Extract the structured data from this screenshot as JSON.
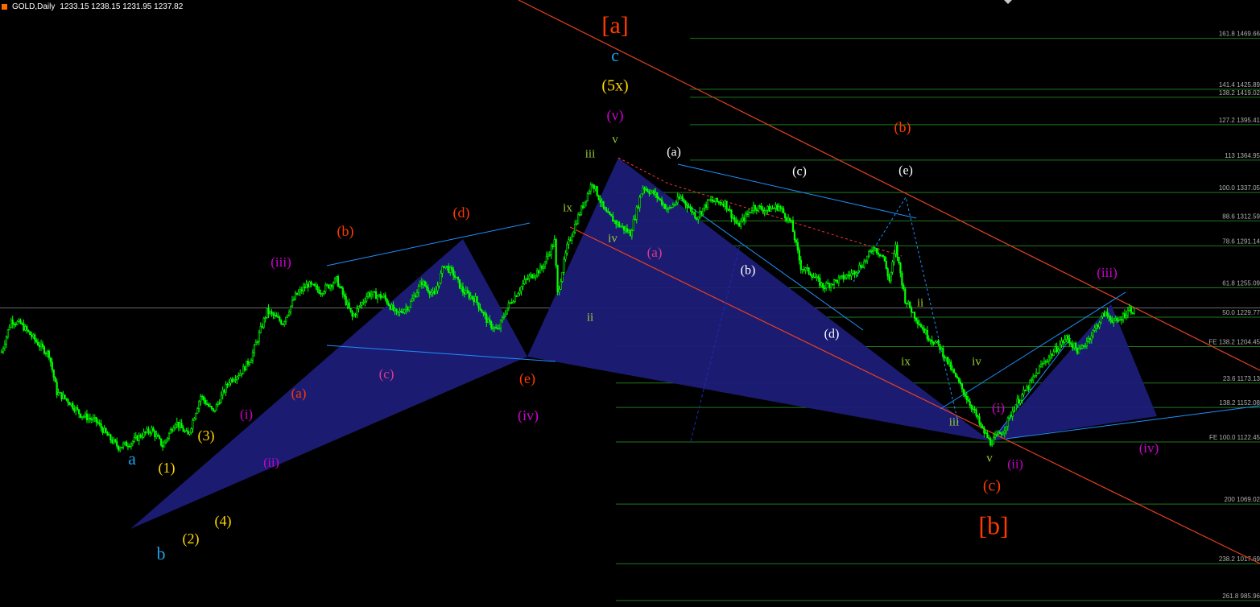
{
  "header": {
    "symbol_tf": "GOLD,Daily",
    "ohlc": "1233.15 1238.15 1231.95 1237.82"
  },
  "chart_data": {
    "type": "candlestick",
    "title": "GOLD,Daily",
    "x": "trading days (unlabeled)",
    "ylim": [
      970,
      1490
    ],
    "grid": false,
    "close_path": [
      [
        0,
        1200
      ],
      [
        6,
        1227
      ],
      [
        12,
        1224
      ],
      [
        18,
        1215
      ],
      [
        25,
        1204
      ],
      [
        30,
        1198
      ],
      [
        35,
        1165
      ],
      [
        42,
        1158
      ],
      [
        50,
        1146
      ],
      [
        60,
        1140
      ],
      [
        68,
        1126
      ],
      [
        74,
        1118
      ],
      [
        82,
        1122
      ],
      [
        88,
        1128
      ],
      [
        95,
        1133
      ],
      [
        102,
        1119
      ],
      [
        110,
        1140
      ],
      [
        118,
        1128
      ],
      [
        126,
        1162
      ],
      [
        134,
        1148
      ],
      [
        144,
        1175
      ],
      [
        152,
        1183
      ],
      [
        158,
        1195
      ],
      [
        168,
        1235
      ],
      [
        178,
        1225
      ],
      [
        186,
        1248
      ],
      [
        194,
        1258
      ],
      [
        202,
        1252
      ],
      [
        212,
        1262
      ],
      [
        222,
        1230
      ],
      [
        232,
        1250
      ],
      [
        242,
        1247
      ],
      [
        250,
        1232
      ],
      [
        258,
        1240
      ],
      [
        266,
        1260
      ],
      [
        274,
        1248
      ],
      [
        280,
        1275
      ],
      [
        286,
        1267
      ],
      [
        292,
        1252
      ],
      [
        300,
        1245
      ],
      [
        308,
        1225
      ],
      [
        314,
        1218
      ],
      [
        320,
        1238
      ],
      [
        332,
        1262
      ],
      [
        342,
        1272
      ],
      [
        350,
        1295
      ],
      [
        352,
        1250
      ],
      [
        358,
        1290
      ],
      [
        364,
        1313
      ],
      [
        374,
        1346
      ],
      [
        382,
        1320
      ],
      [
        390,
        1310
      ],
      [
        398,
        1302
      ],
      [
        406,
        1342
      ],
      [
        414,
        1335
      ],
      [
        422,
        1322
      ],
      [
        430,
        1333
      ],
      [
        440,
        1316
      ],
      [
        448,
        1330
      ],
      [
        458,
        1328
      ],
      [
        466,
        1308
      ],
      [
        476,
        1325
      ],
      [
        484,
        1322
      ],
      [
        492,
        1325
      ],
      [
        500,
        1310
      ],
      [
        506,
        1273
      ],
      [
        512,
        1268
      ],
      [
        520,
        1256
      ],
      [
        530,
        1262
      ],
      [
        538,
        1267
      ],
      [
        546,
        1277
      ],
      [
        552,
        1290
      ],
      [
        558,
        1282
      ],
      [
        562,
        1261
      ],
      [
        566,
        1290
      ],
      [
        572,
        1245
      ],
      [
        578,
        1231
      ],
      [
        586,
        1214
      ],
      [
        594,
        1204
      ],
      [
        602,
        1183
      ],
      [
        608,
        1168
      ],
      [
        616,
        1148
      ],
      [
        620,
        1135
      ],
      [
        626,
        1122
      ],
      [
        634,
        1132
      ],
      [
        642,
        1155
      ],
      [
        650,
        1170
      ],
      [
        658,
        1188
      ],
      [
        666,
        1200
      ],
      [
        674,
        1212
      ],
      [
        682,
        1200
      ],
      [
        690,
        1215
      ],
      [
        698,
        1233
      ],
      [
        706,
        1225
      ],
      [
        714,
        1237
      ],
      [
        718,
        1234
      ]
    ],
    "fib_levels": [
      {
        "pct": "161.8",
        "price": "1469.66",
        "value": 1469.66
      },
      {
        "pct": "141.4",
        "price": "1425.89",
        "value": 1425.89
      },
      {
        "pct": "138.2",
        "price": "1419.02",
        "value": 1419.02
      },
      {
        "pct": "127.2",
        "price": "1395.41",
        "value": 1395.41
      },
      {
        "pct": "113",
        "price": "1364.95",
        "value": 1364.95
      },
      {
        "pct": "100.0",
        "price": "1337.05",
        "value": 1337.05
      },
      {
        "pct": "88.6",
        "price": "1312.59",
        "value": 1312.59
      },
      {
        "pct": "78.6",
        "price": "1291.14",
        "value": 1291.14
      },
      {
        "pct": "61.8",
        "price": "1255.09",
        "value": 1255.09
      },
      {
        "pct": "50.0",
        "price": "1229.77",
        "value": 1229.77
      },
      {
        "pct": "FE 138.2",
        "price": "1204.45",
        "value": 1204.45
      },
      {
        "pct": "23.6",
        "price": "1173.13",
        "value": 1173.13
      },
      {
        "pct": "138.2",
        "price": "1152.08",
        "value": 1152.08
      },
      {
        "pct": "FE 100.0",
        "price": "1122.45",
        "value": 1122.45
      },
      {
        "pct": "200",
        "price": "1069.02",
        "value": 1069.02
      },
      {
        "pct": "238.2",
        "price": "1017.69",
        "value": 1017.69
      },
      {
        "pct": "261.8",
        "price": "985.96",
        "value": 985.96
      }
    ],
    "current_price": 1237.82,
    "wave_labels": [
      {
        "text": "[a]",
        "color": "#ff3a00",
        "size": 30
      },
      {
        "text": "c",
        "color": "#1ea0e6",
        "size": 22
      },
      {
        "text": "(5x)",
        "color": "#ffd700",
        "size": 20
      },
      {
        "text": "(v)",
        "color": "#d000d0",
        "size": 18
      },
      {
        "text": "v",
        "color": "#9acd32",
        "size": 15
      },
      {
        "text": "iii",
        "color": "#9acd32",
        "size": 15
      },
      {
        "text": "ix",
        "color": "#9acd32",
        "size": 15
      },
      {
        "text": "iv",
        "color": "#9acd32",
        "size": 15
      },
      {
        "text": "ii",
        "color": "#9acd32",
        "size": 15
      },
      {
        "text": "(a)",
        "color": "#ffffff",
        "size": 16
      },
      {
        "text": "(a)",
        "color": "#dc3a8c",
        "size": 17
      },
      {
        "text": "(b)",
        "color": "#ff3a00",
        "size": 18
      },
      {
        "text": "(d)",
        "color": "#ff3a00",
        "size": 18
      },
      {
        "text": "(iii)",
        "color": "#d000d0",
        "size": 17
      },
      {
        "text": "(c)",
        "color": "#dc3a8c",
        "size": 17
      },
      {
        "text": "(e)",
        "color": "#ff3a00",
        "size": 18
      },
      {
        "text": "(iv)",
        "color": "#d000d0",
        "size": 18
      },
      {
        "text": "(a)",
        "color": "#ff3a00",
        "size": 17
      },
      {
        "text": "(i)",
        "color": "#d000d0",
        "size": 17
      },
      {
        "text": "(ii)",
        "color": "#d000d0",
        "size": 16
      },
      {
        "text": "(3)",
        "color": "#ffd700",
        "size": 18
      },
      {
        "text": "(1)",
        "color": "#ffd700",
        "size": 18
      },
      {
        "text": "(2)",
        "color": "#ffd700",
        "size": 18
      },
      {
        "text": "(4)",
        "color": "#ffd700",
        "size": 18
      },
      {
        "text": "a",
        "color": "#1ea0e6",
        "size": 22
      },
      {
        "text": "b",
        "color": "#1ea0e6",
        "size": 22
      },
      {
        "text": "(c)",
        "color": "#ffffff",
        "size": 16
      },
      {
        "text": "(b)",
        "color": "#ffffff",
        "size": 16
      },
      {
        "text": "(d)",
        "color": "#ffffff",
        "size": 16
      },
      {
        "text": "(b)",
        "color": "#ff3a00",
        "size": 18
      },
      {
        "text": "(e)",
        "color": "#ffffff",
        "size": 16
      },
      {
        "text": "ii",
        "color": "#9acd32",
        "size": 15
      },
      {
        "text": "ix",
        "color": "#9acd32",
        "size": 15
      },
      {
        "text": "iv",
        "color": "#9acd32",
        "size": 15
      },
      {
        "text": "iii",
        "color": "#9acd32",
        "size": 15
      },
      {
        "text": "v",
        "color": "#9acd32",
        "size": 15
      },
      {
        "text": "(i)",
        "color": "#d000d0",
        "size": 17
      },
      {
        "text": "(ii)",
        "color": "#d000d0",
        "size": 16
      },
      {
        "text": "(c)",
        "color": "#ff3a00",
        "size": 20
      },
      {
        "text": "[b]",
        "color": "#ff3a00",
        "size": 32
      },
      {
        "text": "(iii)",
        "color": "#d000d0",
        "size": 17
      },
      {
        "text": "(iv)",
        "color": "#d000d0",
        "size": 17
      }
    ],
    "colors": {
      "background": "#000000",
      "candles": "#00ff00",
      "pattern_fill": "#1c1c78",
      "trend_lines": "#1e90ff",
      "channel": "#e8401e",
      "fib_lines": "#1e7a1e",
      "fib_text": "#b0b0b0"
    }
  }
}
